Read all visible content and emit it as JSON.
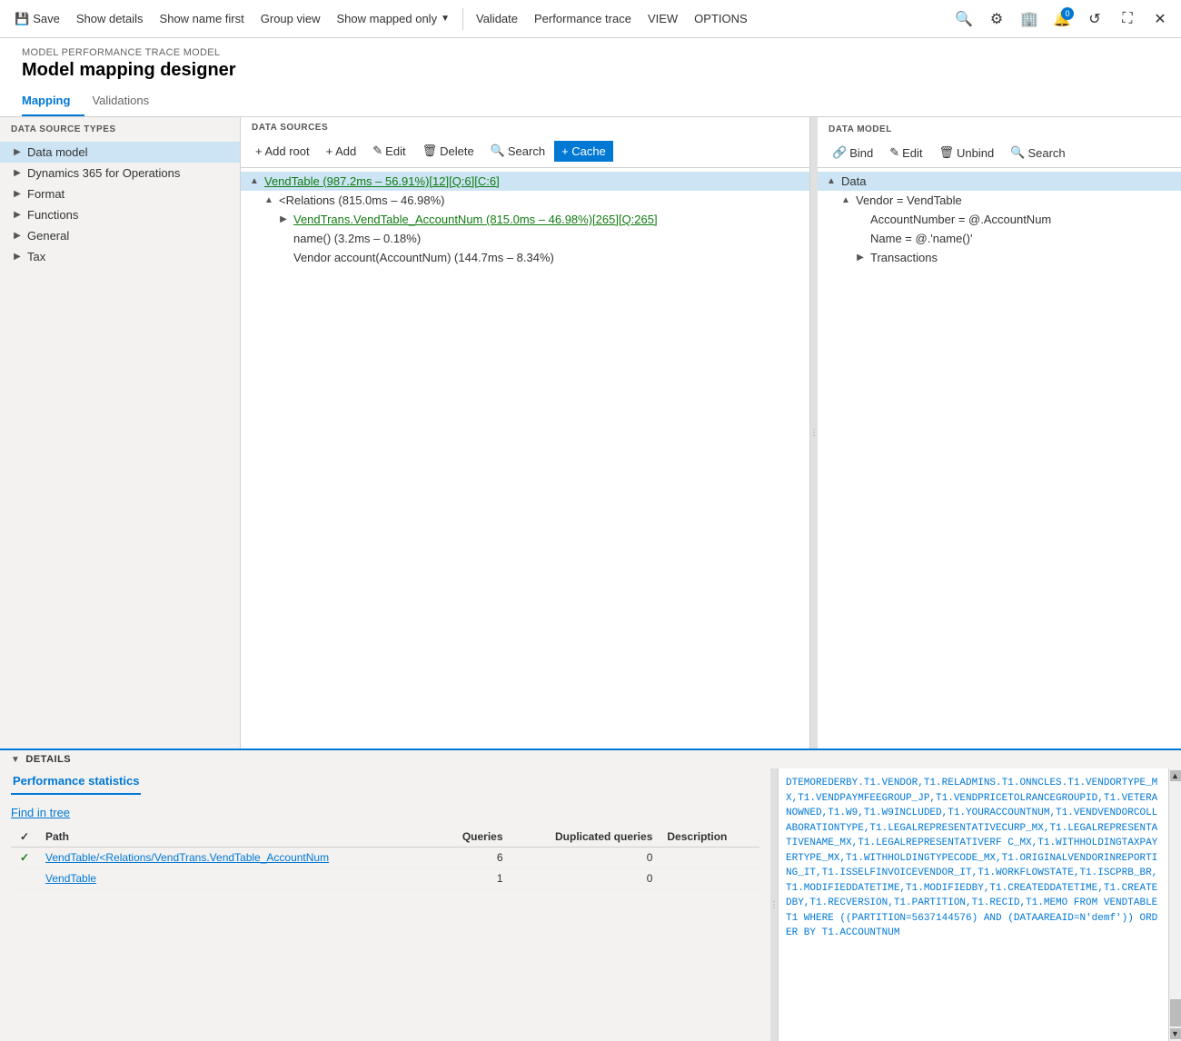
{
  "toolbar": {
    "save_label": "Save",
    "show_details_label": "Show details",
    "show_name_label": "Show name first",
    "group_view_label": "Group view",
    "show_mapped_label": "Show mapped only",
    "validate_label": "Validate",
    "performance_trace_label": "Performance trace",
    "view_label": "VIEW",
    "options_label": "OPTIONS"
  },
  "breadcrumb": "MODEL PERFORMANCE TRACE MODEL",
  "page_title": "Model mapping designer",
  "tabs": [
    {
      "label": "Mapping",
      "active": true
    },
    {
      "label": "Validations",
      "active": false
    }
  ],
  "left_panel": {
    "section_label": "DATA SOURCE TYPES",
    "items": [
      {
        "label": "Data model",
        "selected": true
      },
      {
        "label": "Dynamics 365 for Operations",
        "selected": false
      },
      {
        "label": "Format",
        "selected": false
      },
      {
        "label": "Functions",
        "selected": false
      },
      {
        "label": "General",
        "selected": false
      },
      {
        "label": "Tax",
        "selected": false
      }
    ]
  },
  "center_panel": {
    "section_label": "DATA SOURCES",
    "toolbar": {
      "add_root": "+ Add root",
      "add": "+ Add",
      "edit": "✎ Edit",
      "delete": "🗑 Delete",
      "search": "🔍 Search",
      "cache": "+ Cache"
    },
    "tree": [
      {
        "indent": 0,
        "arrow": "▲",
        "text": "VendTable (987.2ms – 56.91%)[12][Q:6][C:6]",
        "highlight": true,
        "selected": true
      },
      {
        "indent": 1,
        "arrow": "▲",
        "text": "<Relations (815.0ms – 46.98%)",
        "highlight": false
      },
      {
        "indent": 2,
        "arrow": "▶",
        "text": "VendTrans.VendTable_AccountNum (815.0ms – 46.98%)[265][Q:265]",
        "highlight": true
      },
      {
        "indent": 2,
        "arrow": "",
        "text": "name() (3.2ms – 0.18%)",
        "highlight": false
      },
      {
        "indent": 2,
        "arrow": "",
        "text": "Vendor account(AccountNum) (144.7ms – 8.34%)",
        "highlight": false
      }
    ]
  },
  "right_panel": {
    "section_label": "DATA MODEL",
    "toolbar": {
      "bind": "Bind",
      "edit": "Edit",
      "unbind": "Unbind",
      "search": "Search"
    },
    "tree": [
      {
        "indent": 0,
        "arrow": "▲",
        "text": "Data",
        "selected": true
      },
      {
        "indent": 1,
        "arrow": "▲",
        "text": "Vendor = VendTable"
      },
      {
        "indent": 2,
        "arrow": "",
        "text": "AccountNumber = @.AccountNum"
      },
      {
        "indent": 2,
        "arrow": "",
        "text": "Name = @.'name()'"
      },
      {
        "indent": 2,
        "arrow": "▶",
        "text": "Transactions"
      }
    ]
  },
  "bottom_section": {
    "section_label": "DETAILS",
    "perf_tab_label": "Performance statistics",
    "find_tree_label": "Find in tree",
    "table": {
      "headers": [
        "",
        "Path",
        "Queries",
        "Duplicated queries",
        "Description"
      ],
      "rows": [
        {
          "check": true,
          "path": "VendTable/<Relations/VendTrans.VendTable_AccountNum",
          "queries": "6",
          "dup_queries": "0",
          "desc": ""
        },
        {
          "check": false,
          "path": "VendTable",
          "queries": "1",
          "dup_queries": "0",
          "desc": ""
        }
      ]
    },
    "sql_text": "DTEMOREDERBY.T1.VENDOR,T1.RELADMINS.T1.ONNCLES.T1.VENDORTYPE_MX,T1.VENDPAYMFEEGROUP_JP,T1.VENDPRICETOLRANCEGROUPID,T1.VETERANOWNED,T1.W9,T1.W9INCLUDED,T1.YOURACCOUNTNUM,T1.VENDVENDORCOLLABORATIONTYPE,T1.LEGALREPRESENTATIVECURP_MX,T1.LEGALREPRESENTATIVENAME_MX,T1.LEGALREPRESENTATIVERF C_MX,T1.WITHHOLDINGTAXPAYERTYPE_MX,T1.WITHHOLDINGTYPECODE_MX,T1.ORIGINALVENDORINREPORTING_IT,T1.ISSELFINVOICEVENDOR_IT,T1.WORKFLOWSTATE,T1.ISCPRB_BR,T1.MODIFIEDDATETIME,T1.MODIFIEDBY,T1.CREATEDDATETIME,T1.CREATEDBY,T1.RECVERSION,T1.PARTITION,T1.RECID,T1.MEMO FROM VENDTABLE T1 WHERE ((PARTITION=5637144576) AND (DATAAREAID=N'demf')) ORDER BY T1.ACCOUNTNUM"
  }
}
